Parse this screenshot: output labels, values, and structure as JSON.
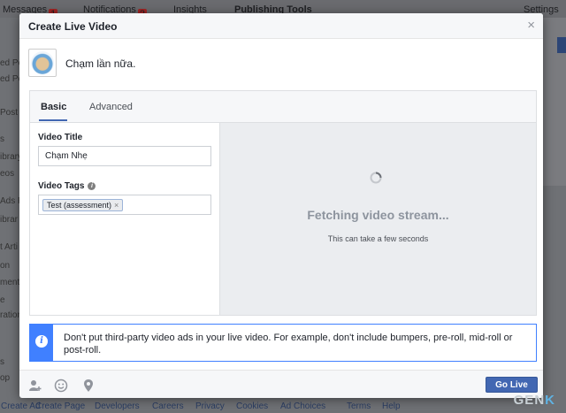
{
  "background": {
    "topbar": [
      "Messages",
      "Notifications",
      "Insights",
      "Publishing Tools",
      "Settings"
    ],
    "messages_badge": "1",
    "notifications_badge": "2",
    "left_fragments": [
      "ed Po",
      "ed Po",
      "Post",
      "s",
      "ibrary",
      "eos",
      "Ads F",
      "ibrar",
      "t Arti",
      "on",
      "ments",
      "e",
      "rations",
      "s",
      "op"
    ],
    "footer_links": [
      "Create Ad",
      "Create Page",
      "Developers",
      "Careers",
      "Privacy",
      "Cookies",
      "Ad Choices",
      "Terms",
      "Help"
    ]
  },
  "modal": {
    "title": "Create Live Video",
    "close": "×",
    "status_text": "Chạm lần nữa.",
    "tabs": [
      {
        "label": "Basic",
        "active": true
      },
      {
        "label": "Advanced",
        "active": false
      }
    ],
    "form": {
      "video_title_label": "Video Title",
      "video_title_value": "Chạm Nhẹ",
      "video_tags_label": "Video Tags",
      "tags": [
        "Test (assessment)"
      ],
      "tag_remove": "×"
    },
    "preview": {
      "title": "Fetching video stream...",
      "subtitle": "This can take a few seconds"
    },
    "notice": {
      "icon": "i",
      "text": "Don't put third-party video ads in your live video. For example, don't include bumpers, pre-roll, mid-roll or post-roll."
    },
    "footer": {
      "icons": [
        "tag-people-icon",
        "feeling-icon",
        "location-icon"
      ],
      "go_live_label": "Go Live"
    }
  },
  "watermark": {
    "text": "GEN",
    "accent": "K"
  },
  "colors": {
    "brand_blue": "#4267b2",
    "notice_blue": "#4080ff",
    "preview_bg": "#ebedf0"
  }
}
